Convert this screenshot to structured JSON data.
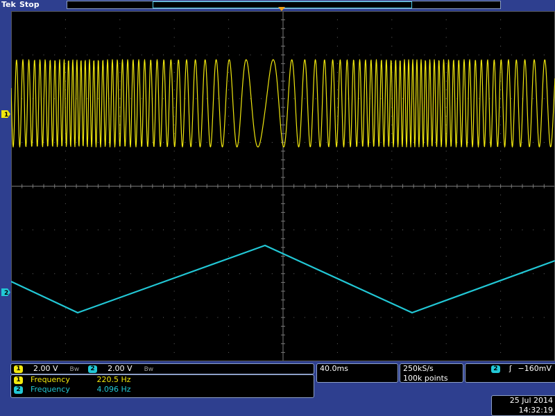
{
  "top_bar": {
    "brand": "Tek",
    "status": "Stop"
  },
  "channels": {
    "ch1": {
      "badge": "1",
      "color": "#f1e80f"
    },
    "ch2": {
      "badge": "2",
      "color": "#22c8d6"
    }
  },
  "vertical": {
    "ch1_scale": "2.00 V",
    "ch2_scale": "2.00 V",
    "bw_symbol": "Bw"
  },
  "measurements": [
    {
      "badge": "1",
      "label": "Frequency",
      "value": "220.5 Hz"
    },
    {
      "badge": "2",
      "label": "Frequency",
      "value": "4.096 Hz"
    }
  ],
  "horizontal": {
    "scale": "40.0ms"
  },
  "acquisition": {
    "sample_rate": "250kS/s",
    "record_length": "100k points"
  },
  "trigger": {
    "source_badge": "2",
    "slope_symbol": "ʃ",
    "level": "−160mV"
  },
  "datetime": {
    "date": "25 Jul  2014",
    "time": "14:32:19"
  }
}
